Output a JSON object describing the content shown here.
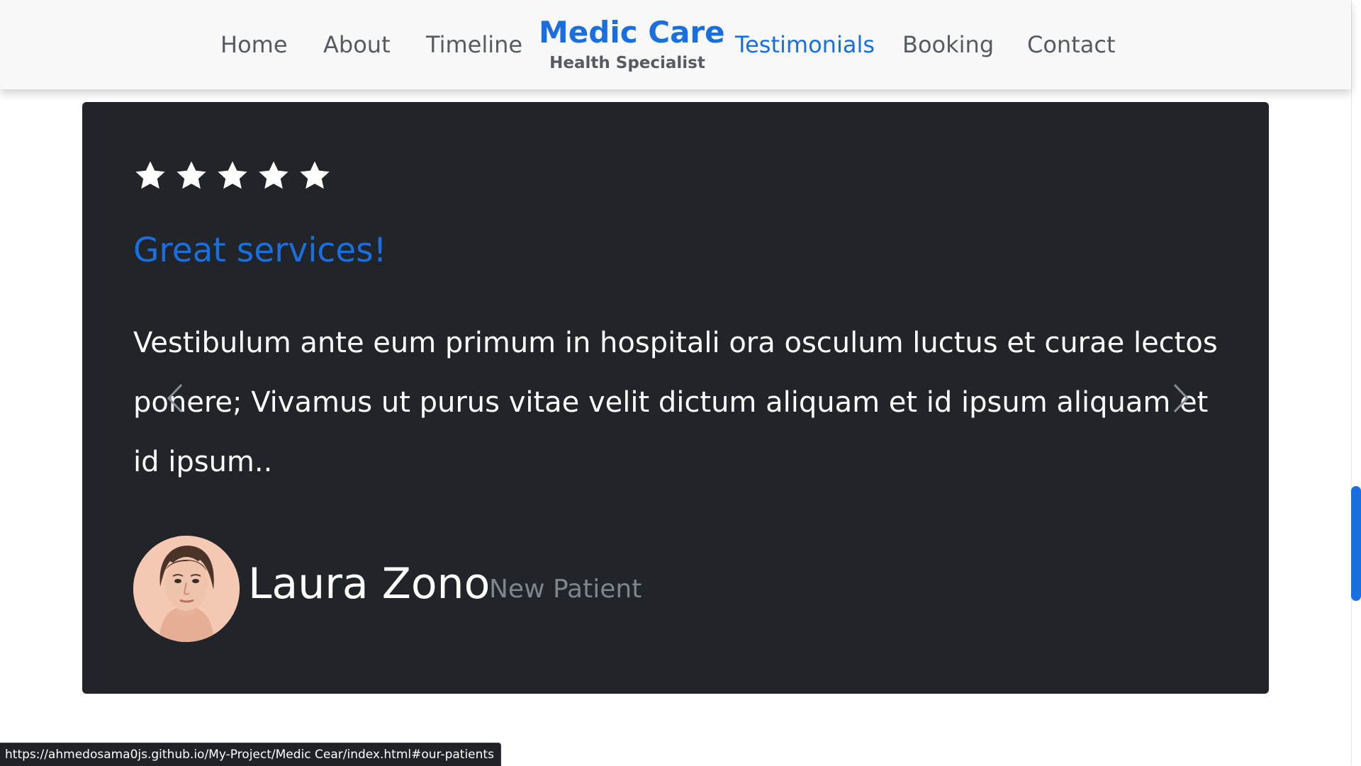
{
  "nav": {
    "left_links": [
      {
        "label": "Home"
      },
      {
        "label": "About"
      },
      {
        "label": "Timeline"
      }
    ],
    "brand": {
      "name": "Medic Care",
      "tagline": "Health Specialist"
    },
    "right_links": [
      {
        "label": "Testimonials",
        "active": true
      },
      {
        "label": "Booking"
      },
      {
        "label": "Contact"
      }
    ]
  },
  "testimonial": {
    "rating": 5,
    "max_rating": 5,
    "title": "Great services!",
    "text": "Vestibulum ante eum primum in hospitali ora osculum luctus et curae lectos ponere; Vivamus ut purus vitae velit dictum aliquam et id ipsum aliquam et id ipsum..",
    "author": {
      "name": "Laura Zono",
      "role": "New Patient"
    }
  },
  "carousel": {
    "prev_icon": "chevron-left-icon",
    "next_icon": "chevron-right-icon"
  },
  "status_bar": {
    "url": "https://ahmedosama0js.github.io/My-Project/Medic Cear/index.html#our-patients"
  },
  "colors": {
    "accent": "#1a6fe0",
    "card_bg": "#212429",
    "nav_text": "#555b61",
    "muted": "#7e858d"
  }
}
